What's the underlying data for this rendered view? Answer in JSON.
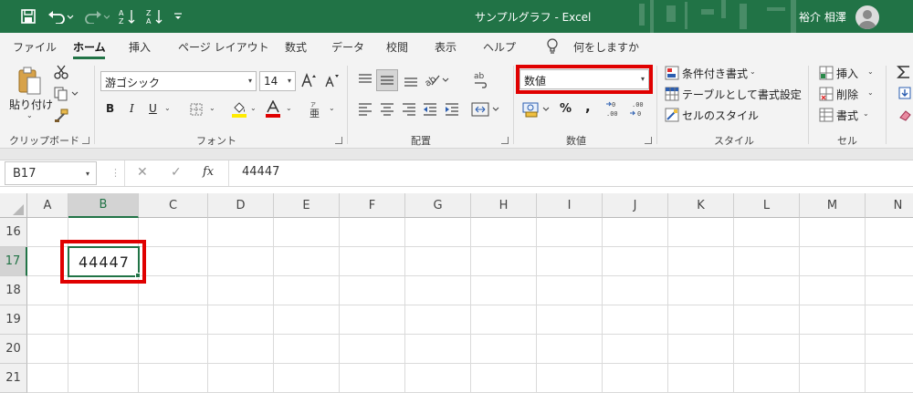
{
  "titlebar": {
    "doc_title": "サンプルグラフ  -  Excel",
    "user_name": "裕介 相澤",
    "bg_color": "#217346"
  },
  "tabs": [
    "ファイル",
    "ホーム",
    "挿入",
    "ページ レイアウト",
    "数式",
    "データ",
    "校閲",
    "表示",
    "ヘルプ"
  ],
  "tell_me": "何をしますか",
  "ribbon": {
    "clipboard": {
      "paste": "貼り付け",
      "label": "クリップボード"
    },
    "font": {
      "name": "游ゴシック",
      "size": "14",
      "label": "フォント"
    },
    "alignment": {
      "label": "配置"
    },
    "number": {
      "format": "数値",
      "percent": "%",
      "comma": ",",
      "label": "数値"
    },
    "styles": {
      "conditional": "条件付き書式",
      "table": "テーブルとして書式設定",
      "cell_styles": "セルのスタイル",
      "label": "スタイル"
    },
    "cells": {
      "insert": "挿入",
      "delete": "削除",
      "format": "書式",
      "label": "セル"
    }
  },
  "formula_bar": {
    "name_box": "B17",
    "fx": "fx",
    "content": "44447"
  },
  "grid": {
    "columns": [
      "A",
      "B",
      "C",
      "D",
      "E",
      "F",
      "G",
      "H",
      "I",
      "J",
      "K",
      "L",
      "M",
      "N"
    ],
    "rows": [
      "16",
      "17",
      "18",
      "19",
      "20",
      "21"
    ],
    "selected_cell": "B17",
    "cell_value": "44447"
  },
  "colors": {
    "accent": "#217346",
    "highlight": "#e00000"
  }
}
